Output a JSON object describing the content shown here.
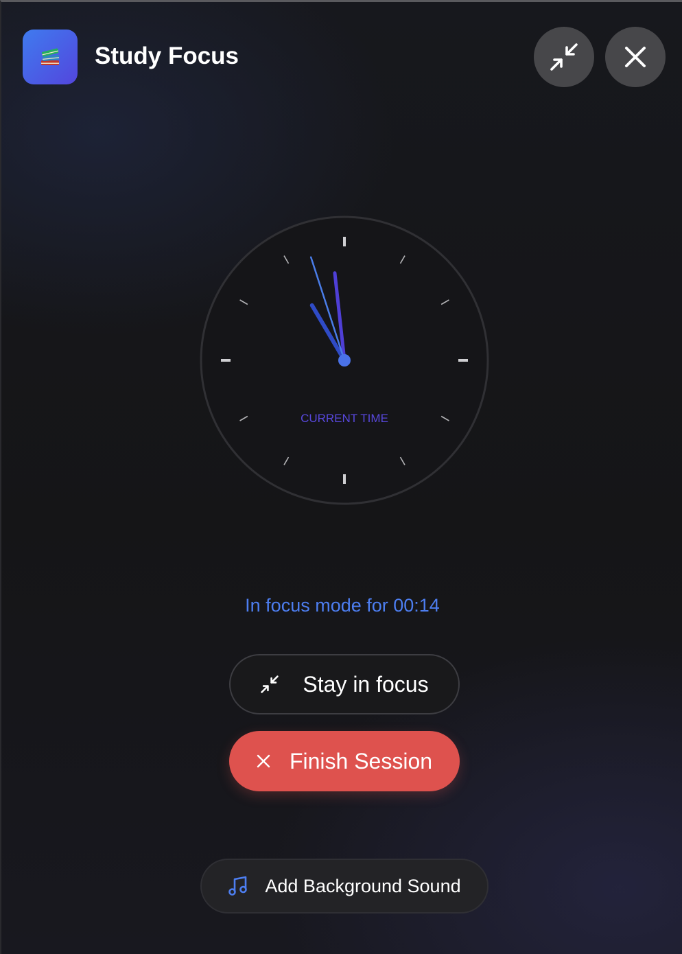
{
  "header": {
    "title": "Study Focus",
    "app_icon": "books-icon",
    "minimize_icon": "minimize-arrows-icon",
    "close_icon": "close-icon"
  },
  "clock": {
    "label": "CURRENT TIME",
    "time": {
      "hours": 10,
      "minutes": 58,
      "seconds": 57
    },
    "colors": {
      "hour_hand": "#2f4bc6",
      "minute_hand": "#4f3fd6",
      "second_hand": "#4a7de8",
      "center": "#4a72e8",
      "label": "#5848dd"
    }
  },
  "status": {
    "text": "In focus mode for 00:14",
    "color": "#4d7ef0"
  },
  "buttons": {
    "stay_focus": {
      "label": "Stay in focus",
      "icon": "minimize-arrows-icon"
    },
    "finish_session": {
      "label": "Finish Session",
      "icon": "close-icon",
      "color": "#de524e"
    },
    "background_sound": {
      "label": "Add Background Sound",
      "icon": "music-note-icon"
    }
  }
}
